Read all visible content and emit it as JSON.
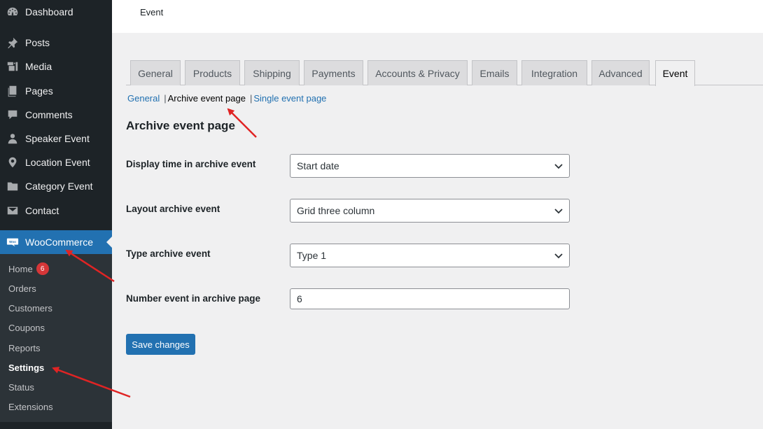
{
  "sidebar": {
    "items": [
      {
        "label": "Dashboard",
        "icon": "dashboard-icon"
      },
      {
        "label": "Posts",
        "icon": "pin-icon"
      },
      {
        "label": "Media",
        "icon": "media-icon"
      },
      {
        "label": "Pages",
        "icon": "pages-icon"
      },
      {
        "label": "Comments",
        "icon": "comment-icon"
      },
      {
        "label": "Speaker Event",
        "icon": "person-icon"
      },
      {
        "label": "Location Event",
        "icon": "location-pin-icon"
      },
      {
        "label": "Category Event",
        "icon": "folder-icon"
      },
      {
        "label": "Contact",
        "icon": "mail-icon"
      },
      {
        "label": "WooCommerce",
        "icon": "woo-icon"
      }
    ],
    "submenu": [
      {
        "label": "Home",
        "badge": "6"
      },
      {
        "label": "Orders"
      },
      {
        "label": "Customers"
      },
      {
        "label": "Coupons"
      },
      {
        "label": "Reports"
      },
      {
        "label": "Settings"
      },
      {
        "label": "Status"
      },
      {
        "label": "Extensions"
      }
    ]
  },
  "topbar": {
    "title": "Event"
  },
  "tabs": [
    "General",
    "Products",
    "Shipping",
    "Payments",
    "Accounts & Privacy",
    "Emails",
    "Integration",
    "Advanced",
    "Event"
  ],
  "subsub": {
    "general": "General",
    "archive": "Archive event page",
    "single": "Single event page",
    "sep": "|"
  },
  "page": {
    "heading": "Archive event page"
  },
  "form": {
    "display_time": {
      "label": "Display time in archive event",
      "value": "Start date"
    },
    "layout": {
      "label": "Layout archive event",
      "value": "Grid three column"
    },
    "type": {
      "label": "Type archive event",
      "value": "Type 1"
    },
    "number": {
      "label": "Number event in archive page",
      "value": "6"
    }
  },
  "save_label": "Save changes",
  "colors": {
    "accent": "#2271b1",
    "sidebar_bg": "#1d2327",
    "annotation_arrow": "#e02424"
  }
}
